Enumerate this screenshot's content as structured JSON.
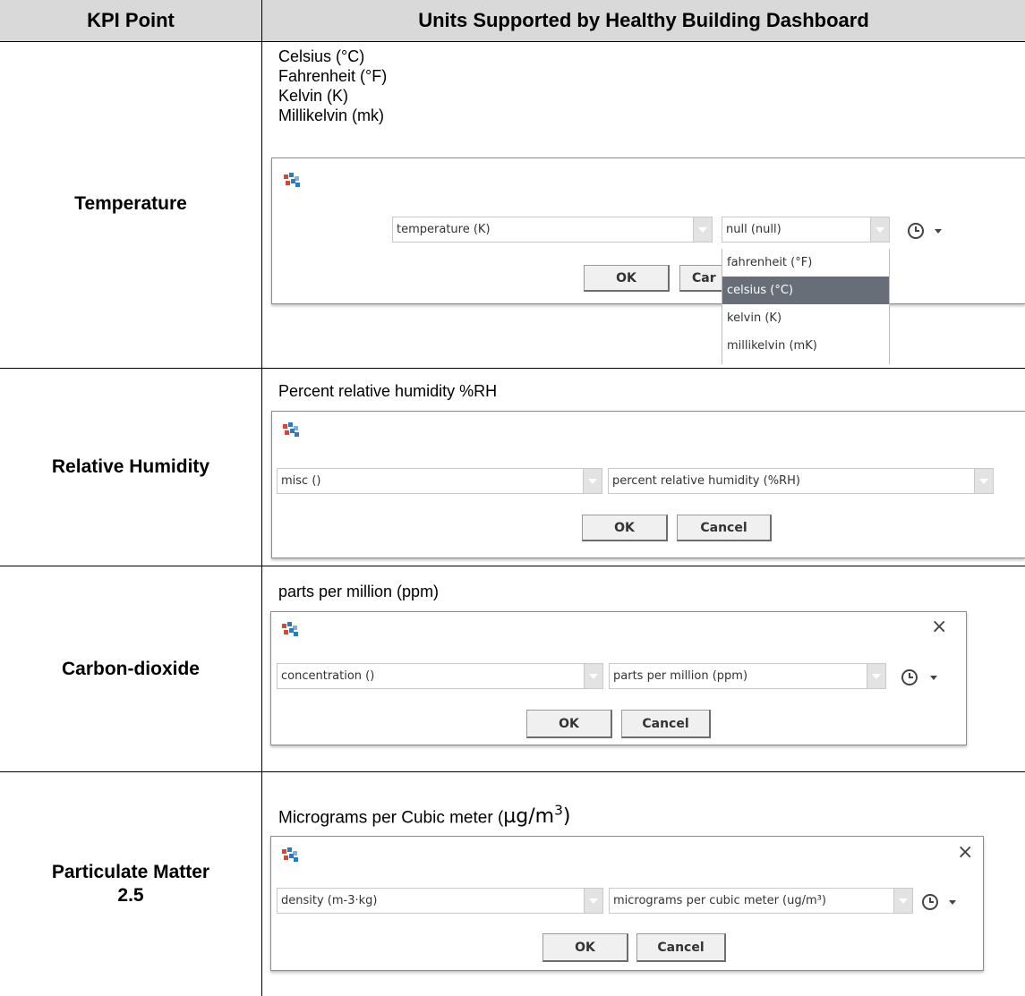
{
  "table": {
    "headers": [
      "KPI Point",
      "Units Supported by Healthy Building Dashboard"
    ],
    "rows": [
      {
        "kpi": "Temperature",
        "units_lines": [
          "Celsius (°C)",
          "Fahrenheit (°F)",
          "Kelvin (K)",
          "Millikelvin (mk)"
        ],
        "dialog": {
          "quantity_value": "temperature (K)",
          "unit_value": "null (null)",
          "ok_label": "OK",
          "cancel_label_visible": "Car",
          "dropdown_options": [
            "fahrenheit (°F)",
            "celsius (°C)",
            "kelvin (K)",
            "millikelvin (mK)"
          ],
          "dropdown_selected": "celsius (°C)"
        }
      },
      {
        "kpi": "Relative Humidity",
        "units_lines": [
          "Percent relative humidity %RH"
        ],
        "dialog": {
          "quantity_value": "misc ()",
          "unit_value": "percent relative humidity (%RH)",
          "ok_label": "OK",
          "cancel_label": "Cancel"
        }
      },
      {
        "kpi": "Carbon-dioxide",
        "units_lines": [
          "parts per million (ppm)"
        ],
        "dialog": {
          "quantity_value": "concentration ()",
          "unit_value": "parts per million (ppm)",
          "ok_label": "OK",
          "cancel_label": "Cancel",
          "close_glyph": "×"
        }
      },
      {
        "kpi_lines": [
          "Particulate Matter",
          "2.5"
        ],
        "units_text": "Micrograms per Cubic meter (",
        "units_formula_unit": "µg/m",
        "units_formula_exp": "3",
        "units_formula_close": ")",
        "dialog": {
          "quantity_value": "density (m-3·kg)",
          "unit_value": "micrograms per cubic meter (ug/m³)",
          "ok_label": "OK",
          "cancel_label": "Cancel",
          "close_glyph": "×"
        }
      }
    ]
  },
  "colors": {
    "header_bg": "#d9d9d9",
    "dropdown_selected_bg": "#676e77",
    "dialog_border": "#8c8c8c"
  },
  "icons": [
    "app-logo-icon",
    "dropdown-arrow-icon",
    "history-clock-icon",
    "close-icon"
  ]
}
